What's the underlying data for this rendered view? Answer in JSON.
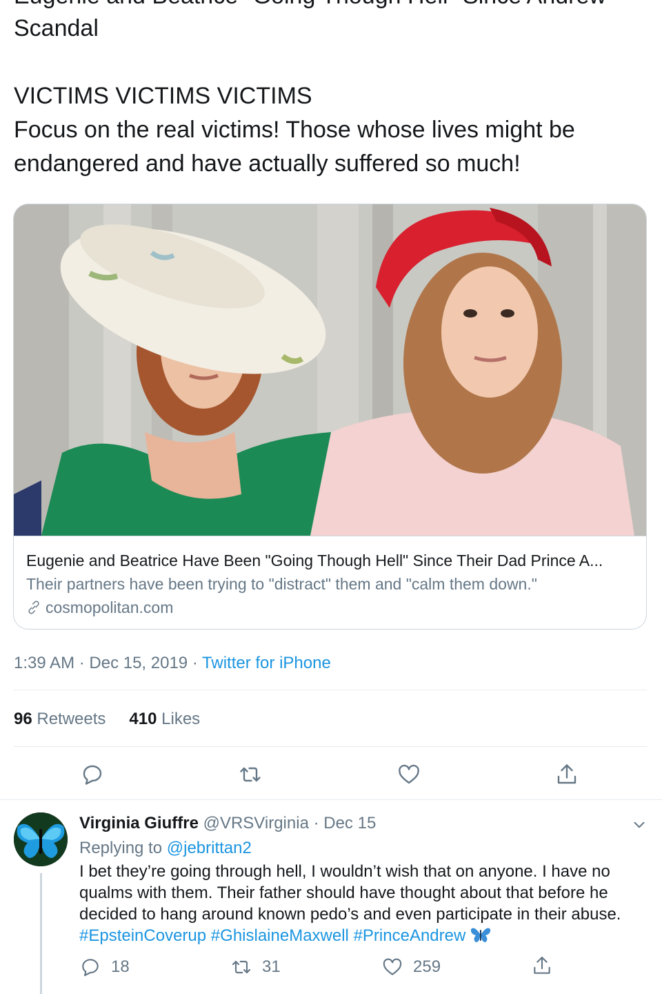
{
  "tweet": {
    "cut_title_line": "Eugenie and Beatrice \"Going Though Hell\" Since Andrew",
    "lines": [
      "Scandal",
      "",
      "VICTIMS VICTIMS VICTIMS",
      "Focus on the real victims!  Those whose lives might be",
      "endangered and have actually suffered so much!"
    ],
    "timestamp": "1:39 AM · Dec 15, 2019 · ",
    "source": "Twitter for iPhone",
    "stats": {
      "retweets_count": "96",
      "retweets_label": "Retweets",
      "likes_count": "410",
      "likes_label": "Likes"
    },
    "action_icons": [
      "reply-icon",
      "retweet-icon",
      "like-icon",
      "share-icon"
    ]
  },
  "link_card": {
    "title": "Eugenie and Beatrice Have Been \"Going Though Hell\" Since Their Dad Prince A...",
    "description": "Their partners have been trying to \"distract\" them and \"calm them down.\"",
    "domain": "cosmopolitan.com",
    "domain_icon": "link-icon"
  },
  "reply": {
    "name": "Virginia Giuffre",
    "handle": "@VRSVirginia",
    "date_sep": " · ",
    "date": "Dec 15",
    "replying_prefix": "Replying to ",
    "replying_to": "@jebrittan2",
    "lines": [
      "I bet they’re going through hell, I wouldn’t wish that on anyone. I have no",
      "qualms with them. Their father should have thought about that before he",
      "decided to hang around known pedo’s and even participate in their abuse."
    ],
    "hashtags": [
      "#EpsteinCoverup",
      "#GhislaineMaxwell",
      "#PrinceAndrew"
    ],
    "emoji": "butterfly",
    "reply_count": "18",
    "retweet_count": "31",
    "like_count": "259",
    "colors": {
      "link": "#1b95e0",
      "muted": "#657786",
      "text": "#14171a"
    }
  }
}
